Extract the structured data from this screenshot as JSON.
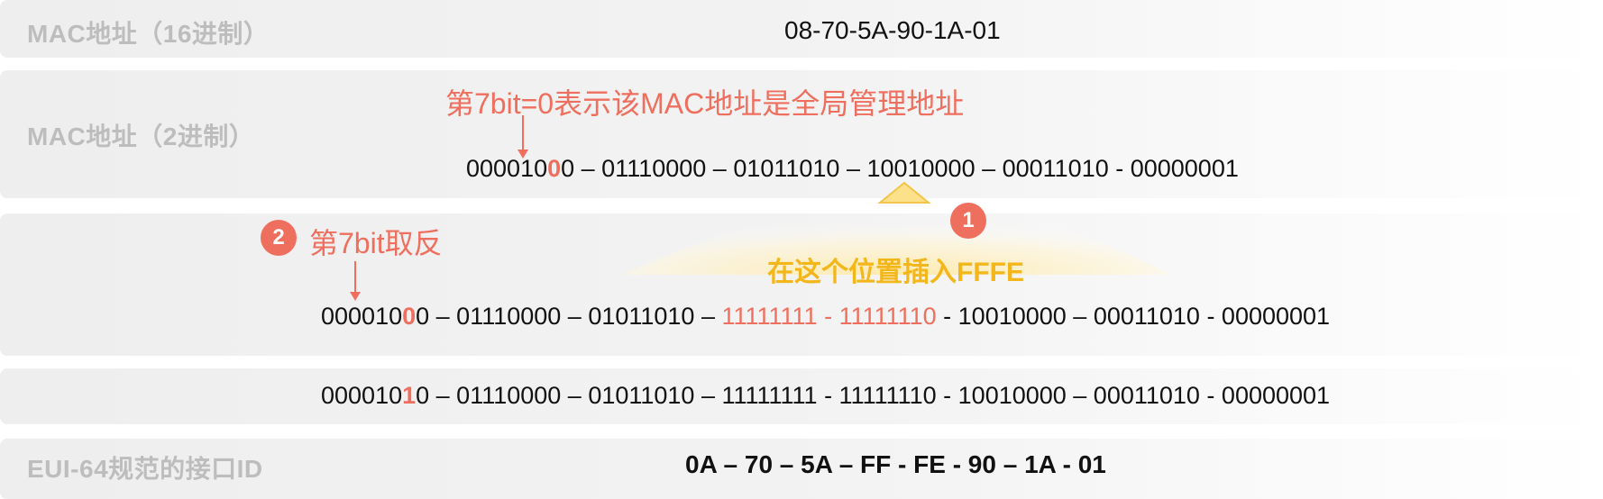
{
  "rows": {
    "hex_label": "MAC地址（16进制）",
    "hex_value": "08-70-5A-90-1A-01",
    "bin_label": "MAC地址（2进制）",
    "eui_label": "EUI-64规范的接口ID",
    "eui_value": "0A – 70 – 5A – FF - FE - 90 – 1A - 01"
  },
  "notes": {
    "global_note": "第7bit=0表示该MAC地址是全局管理地址",
    "step1_badge": "1",
    "insert_note": "在这个位置插入FFFE",
    "step2_badge": "2",
    "flip_note": "第7bit取反"
  },
  "binary": {
    "mac": {
      "pre": "000010",
      "bit": "0",
      "post": "0 – 01110000 – 01011010 – 10010000 – 00011010 - 00000001"
    },
    "inserted": {
      "pre": "000010",
      "bit": "0",
      "mid": "0 – 01110000 – 01011010 – ",
      "ins": "11111111 - 11111110",
      "post": " - 10010000 – 00011010 - 00000001"
    },
    "flipped": {
      "pre": "000010",
      "bit": "1",
      "post": "0 – 01110000 – 01011010 – 11111111 - 11111110 - 10010000 – 00011010 - 00000001"
    }
  },
  "colors": {
    "highlight": "#ef6f5e",
    "insert_text": "#f3b61b",
    "label_gray": "#bdbdbd",
    "band_gray": "#eeeeee"
  }
}
